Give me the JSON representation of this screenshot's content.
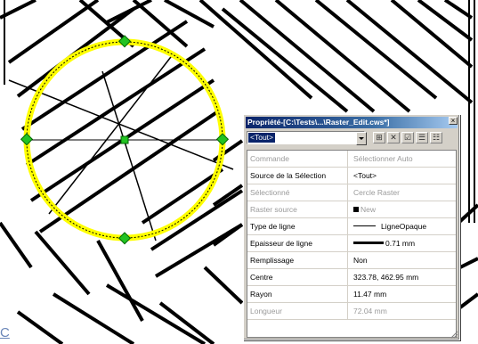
{
  "corner_label": "C",
  "window": {
    "title": "Propriété-[C:\\Tests\\...\\Raster_Edit.cws*]",
    "close_glyph": "×",
    "selector_value": "<Tout>",
    "toolbar": [
      {
        "name": "filter-icon",
        "glyph": "⊞"
      },
      {
        "name": "clear-icon",
        "glyph": "✕"
      },
      {
        "name": "check-icon",
        "glyph": "☑"
      },
      {
        "name": "list-icon",
        "glyph": "☰"
      },
      {
        "name": "sort-icon",
        "glyph": "☷"
      }
    ]
  },
  "properties": [
    {
      "label": "Commande",
      "value": "Sélectionner Auto",
      "dim": true
    },
    {
      "label": "Source de la Sélection",
      "value": "<Tout>",
      "dim": false
    },
    {
      "label": "Sélectionné",
      "value": "Cercle Raster",
      "dim": true
    },
    {
      "label": "Raster source",
      "value": "New",
      "dim": true
    },
    {
      "label": "Type de ligne",
      "value": "LigneOpaque",
      "dim": false
    },
    {
      "label": "Epaisseur de ligne",
      "value": "0.71 mm",
      "dim": false
    },
    {
      "label": "Remplissage",
      "value": "Non",
      "dim": false
    },
    {
      "label": "Centre",
      "value": "323.78, 462.95 mm",
      "dim": false
    },
    {
      "label": "Rayon",
      "value": "11.47 mm",
      "dim": false
    },
    {
      "label": "Longueur",
      "value": "72.04 mm",
      "dim": true
    }
  ],
  "colors": {
    "selection_circle": "#ffff00",
    "handle": "#22c322",
    "title_bar": "#0a246a"
  }
}
